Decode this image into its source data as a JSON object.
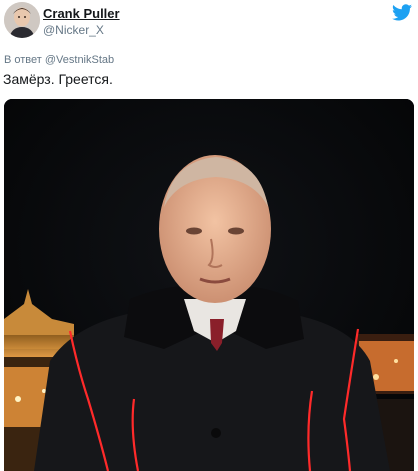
{
  "header": {
    "display_name": "Crank Puller",
    "handle": "@Nicker_X",
    "avatar_icon": "user-avatar",
    "logo_icon": "twitter-bird-icon",
    "accent_color": "#1da1f2"
  },
  "tweet": {
    "reply_context": "В ответ @VestnikStab",
    "text": "Замёрз. Греется."
  },
  "media": {
    "description_icon": "photo",
    "annotation_color": "#ff2a2a"
  }
}
